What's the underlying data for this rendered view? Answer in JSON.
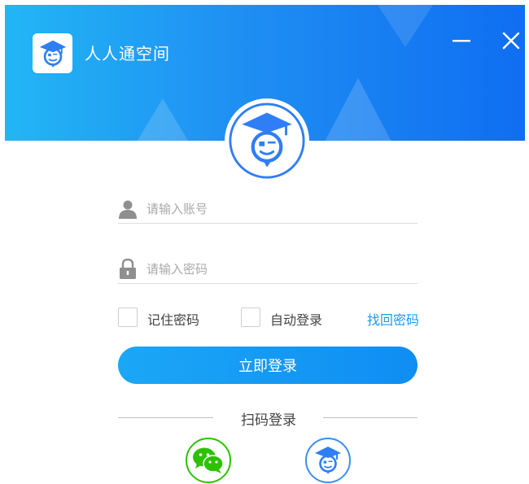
{
  "app": {
    "title": "人人通空间"
  },
  "window": {
    "minimize_icon": "minimize-icon",
    "close_icon": "close-icon"
  },
  "colors": {
    "header_start": "#22b6f5",
    "header_end": "#0f6ef1",
    "accent": "#1a9cf0",
    "wechat": "#2dc100",
    "logo_blue": "#2f7ef5"
  },
  "login": {
    "account_placeholder": "请输入账号",
    "password_placeholder": "请输入密码",
    "remember_label": "记住密码",
    "auto_login_label": "自动登录",
    "forgot_label": "找回密码",
    "submit_label": "立即登录",
    "remember_checked": false,
    "auto_login_checked": false
  },
  "scan": {
    "label": "扫码登录",
    "options": [
      {
        "icon": "wechat-icon"
      },
      {
        "icon": "app-logo-icon"
      }
    ]
  }
}
